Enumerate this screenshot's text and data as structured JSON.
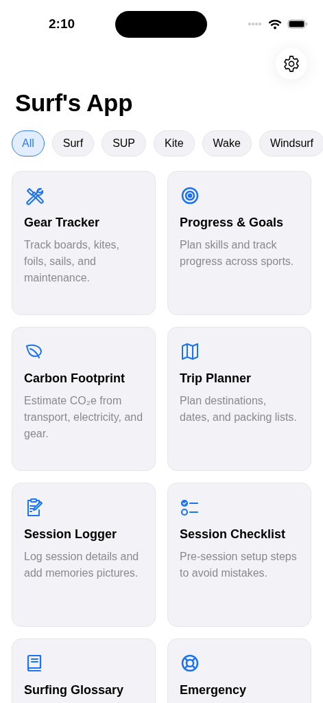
{
  "status_bar": {
    "time": "2:10"
  },
  "title": "Surf's App",
  "filters": [
    {
      "label": "All",
      "selected": true
    },
    {
      "label": "Surf",
      "selected": false
    },
    {
      "label": "SUP",
      "selected": false
    },
    {
      "label": "Kite",
      "selected": false
    },
    {
      "label": "Wake",
      "selected": false
    },
    {
      "label": "Windsurf",
      "selected": false
    }
  ],
  "cards": [
    {
      "kind": "tools",
      "title": "Gear Tracker",
      "description": "Track boards, kites, foils, sails, and maintenance."
    },
    {
      "kind": "target",
      "title": "Progress & Goals",
      "description": "Plan skills and track progress across sports."
    },
    {
      "kind": "leaf",
      "title": "Carbon Footprint",
      "description": "Estimate CO₂e from transport, electricity, and gear."
    },
    {
      "kind": "map",
      "title": "Trip Planner",
      "description": "Plan destinations, dates, and packing lists."
    },
    {
      "kind": "clipboard",
      "title": "Session Logger",
      "description": "Log session details and add memories pictures."
    },
    {
      "kind": "checklist",
      "title": "Session Checklist",
      "description": "Pre-session setup steps to avoid mistakes."
    },
    {
      "kind": "book",
      "title": "Surfing Glossary"
    },
    {
      "kind": "lifebuoy",
      "title": "Emergency"
    }
  ]
}
